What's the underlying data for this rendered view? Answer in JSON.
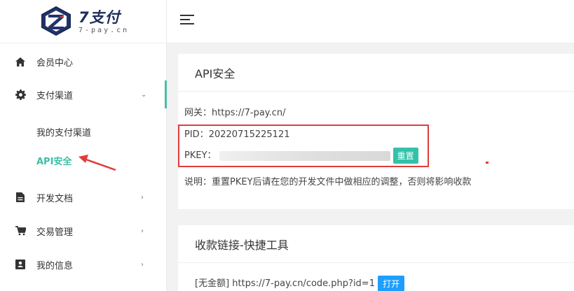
{
  "brand": {
    "title": "7支付",
    "subtitle": "7-pay.cn"
  },
  "sidebar": {
    "items": [
      {
        "label": "会员中心",
        "icon": "home-icon"
      },
      {
        "label": "支付渠道",
        "icon": "gear-icon",
        "expanded": true,
        "children": [
          {
            "label": "我的支付渠道",
            "active": false
          },
          {
            "label": "API安全",
            "active": true
          }
        ]
      },
      {
        "label": "开发文档",
        "icon": "document-icon"
      },
      {
        "label": "交易管理",
        "icon": "cart-icon"
      },
      {
        "label": "我的信息",
        "icon": "id-card-icon"
      }
    ]
  },
  "api_card": {
    "title": "API安全",
    "gateway_label": "网关：",
    "gateway_url": "https://7-pay.cn/",
    "pid_label": "PID：",
    "pid_value": "20220715225121",
    "pkey_label": "PKEY：",
    "reset_label": "重置",
    "note": "说明：重置PKEY后请在您的开发文件中做相应的调整，否则将影响收款"
  },
  "link_card": {
    "title": "收款链接-快捷工具",
    "prefix": "[无金额]",
    "url": "https://7-pay.cn/code.php?id=1",
    "open_label": "打开"
  },
  "colors": {
    "accent": "#3dbfa5",
    "highlight": "#e03b3b",
    "button_blue": "#1e9fff"
  }
}
